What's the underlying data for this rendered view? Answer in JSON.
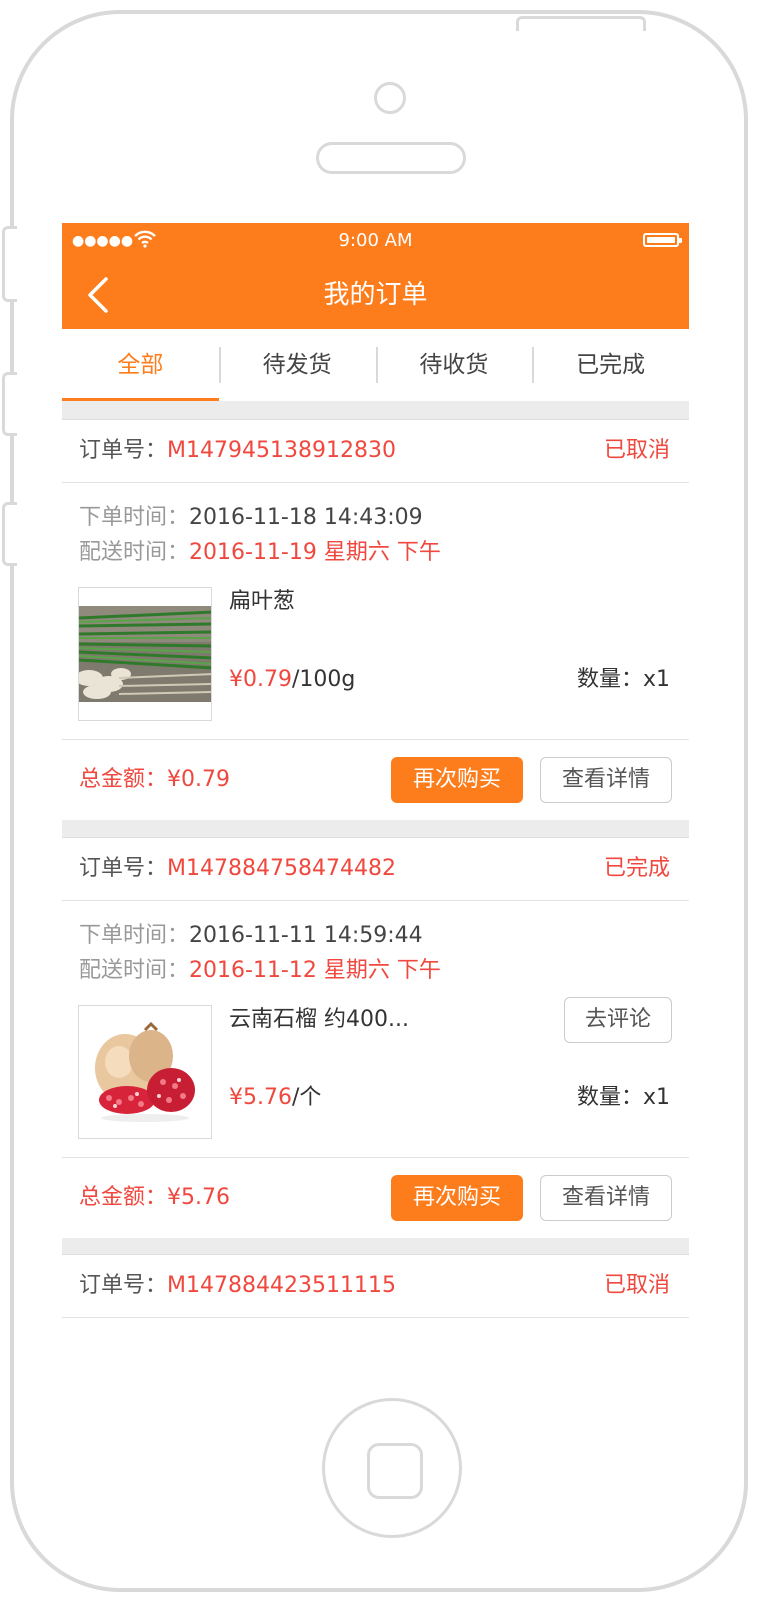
{
  "status_bar": {
    "signal": "●●●●●",
    "time": "9:00 AM"
  },
  "header": {
    "title": "我的订单"
  },
  "tabs": [
    {
      "label": "全部",
      "active": true
    },
    {
      "label": "待发货",
      "active": false
    },
    {
      "label": "待收货",
      "active": false
    },
    {
      "label": "已完成",
      "active": false
    }
  ],
  "labels": {
    "order_no": "订单号：",
    "order_time": "下单时间：",
    "delivery_time": "配送时间：",
    "qty": "数量：",
    "total": "总金额："
  },
  "orders": [
    {
      "order_no": "M147945138912830",
      "status": "已取消",
      "order_time": "2016-11-18 14:43:09",
      "delivery_time": "2016-11-19 星期六 下午",
      "product": {
        "name": "扁叶葱",
        "price": "¥0.79",
        "unit": "/100g",
        "qty": "x1",
        "image": "green-onion"
      },
      "total": "¥0.79",
      "rebuy_label": "再次购买",
      "detail_label": "查看详情"
    },
    {
      "order_no": "M147884758474482",
      "status": "已完成",
      "order_time": "2016-11-11 14:59:44",
      "delivery_time": "2016-11-12 星期六 下午",
      "product": {
        "name": "云南石榴 约400...",
        "price": "¥5.76",
        "unit": "/个",
        "qty": "x1",
        "image": "pomegranate"
      },
      "review_label": "去评论",
      "total": "¥5.76",
      "rebuy_label": "再次购买",
      "detail_label": "查看详情"
    },
    {
      "order_no": "M147884423511115",
      "status": "已取消"
    }
  ],
  "colors": {
    "accent": "#fd7c1b",
    "price_red": "#f0483e",
    "background": "#ececec"
  }
}
